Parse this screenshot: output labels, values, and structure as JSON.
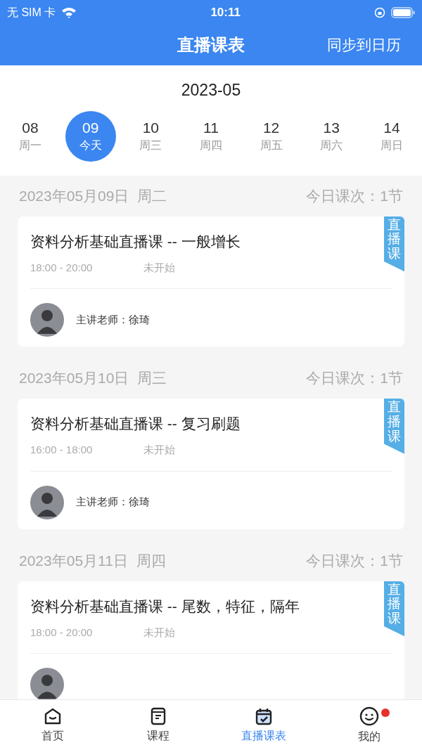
{
  "status_bar": {
    "carrier": "无 SIM 卡",
    "time": "10:11"
  },
  "nav": {
    "title": "直播课表",
    "action": "同步到日历"
  },
  "calendar": {
    "month": "2023-05",
    "days": [
      {
        "date": "08",
        "label": "周一",
        "selected": false
      },
      {
        "date": "09",
        "label": "今天",
        "selected": true
      },
      {
        "date": "10",
        "label": "周三",
        "selected": false
      },
      {
        "date": "11",
        "label": "周四",
        "selected": false
      },
      {
        "date": "12",
        "label": "周五",
        "selected": false
      },
      {
        "date": "13",
        "label": "周六",
        "selected": false
      },
      {
        "date": "14",
        "label": "周日",
        "selected": false
      }
    ]
  },
  "sections": [
    {
      "date": "2023年05月09日  周二",
      "count": "今日课次：1节",
      "lessons": [
        {
          "title": "资料分析基础直播课 -- 一般增长",
          "time": "18:00 - 20:00",
          "status": "未开始",
          "tag": "直播课",
          "teacher": "主讲老师：徐琦"
        }
      ]
    },
    {
      "date": "2023年05月10日  周三",
      "count": "今日课次：1节",
      "lessons": [
        {
          "title": "资料分析基础直播课 -- 复习刷题",
          "time": "16:00 - 18:00",
          "status": "未开始",
          "tag": "直播课",
          "teacher": "主讲老师：徐琦"
        }
      ]
    },
    {
      "date": "2023年05月11日  周四",
      "count": "今日课次：1节",
      "lessons": [
        {
          "title": "资料分析基础直播课 -- 尾数，特征，隔年",
          "time": "18:00 - 20:00",
          "status": "未开始",
          "tag": "直播课"
        }
      ]
    }
  ],
  "tab_bar": [
    {
      "kind": "home",
      "label": "首页",
      "selected": false,
      "badge": false
    },
    {
      "kind": "course",
      "label": "课程",
      "selected": false,
      "badge": false
    },
    {
      "kind": "schedule",
      "label": "直播课表",
      "selected": true,
      "badge": false
    },
    {
      "kind": "me",
      "label": "我的",
      "selected": false,
      "badge": true
    }
  ]
}
